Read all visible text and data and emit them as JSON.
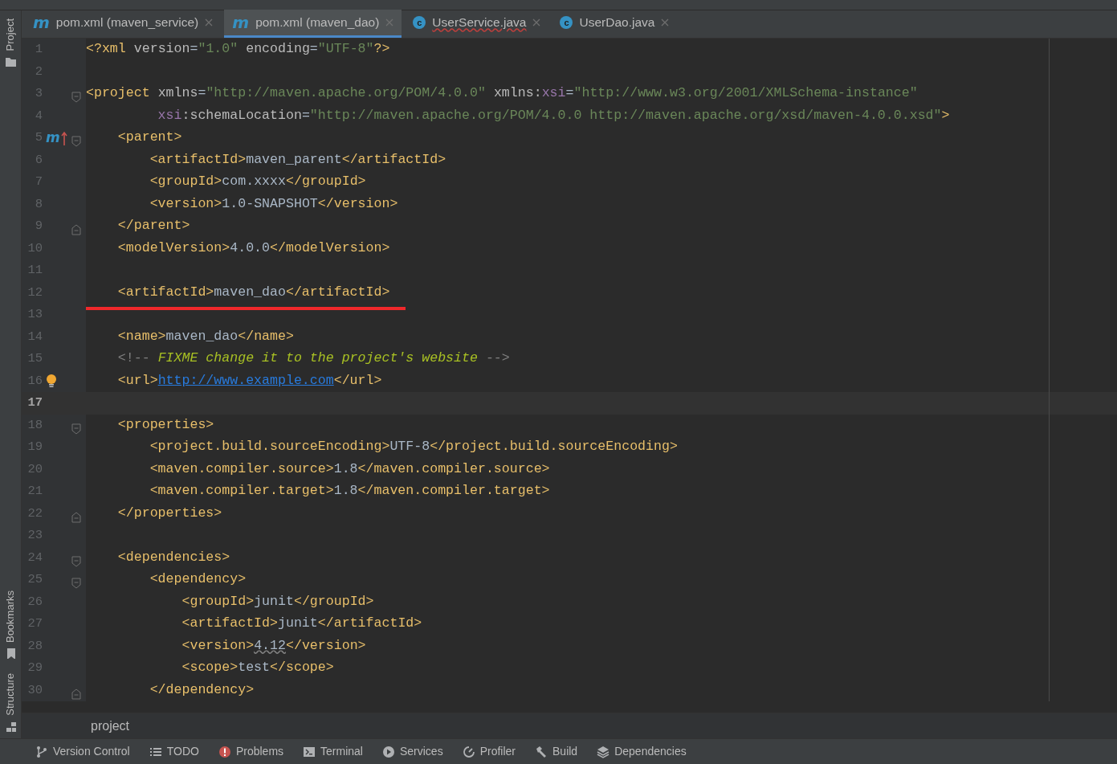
{
  "tool_strip": [
    {
      "label": "Project"
    },
    {
      "label": "Bookmarks"
    },
    {
      "label": "Structure"
    }
  ],
  "tabs": [
    {
      "letter": "m",
      "kind": "maven",
      "label": "pom.xml (maven_service)",
      "selected": false,
      "error": false
    },
    {
      "letter": "m",
      "kind": "maven",
      "label": "pom.xml (maven_dao)",
      "selected": true,
      "error": false
    },
    {
      "letter": "c",
      "kind": "class",
      "label": "UserService.java",
      "selected": false,
      "error": true
    },
    {
      "letter": "c",
      "kind": "class",
      "label": "UserDao.java",
      "selected": false,
      "error": false
    }
  ],
  "editor": {
    "lines": [
      {
        "n": "1",
        "current": false,
        "underlined": false,
        "code": [
          {
            "kind": "tag",
            "text": "<?xml"
          },
          {
            "kind": "attr",
            "text": " version"
          },
          {
            "kind": "plain",
            "text": "="
          },
          {
            "kind": "string",
            "text": "\"1.0\""
          },
          {
            "kind": "attr",
            "text": " encoding"
          },
          {
            "kind": "plain",
            "text": "="
          },
          {
            "kind": "string",
            "text": "\"UTF-8\""
          },
          {
            "kind": "tag",
            "text": "?>"
          }
        ]
      },
      {
        "n": "2",
        "current": false,
        "underlined": false
      },
      {
        "n": "3",
        "current": false,
        "underlined": false,
        "fold": {
          "kind": "start"
        },
        "code": [
          {
            "kind": "tag",
            "text": "<project"
          },
          {
            "kind": "attr",
            "text": " xmlns"
          },
          {
            "kind": "plain",
            "text": "="
          },
          {
            "kind": "string",
            "text": "\"http://maven.apache.org/POM/4.0.0\""
          },
          {
            "kind": "attr",
            "text": " xmlns:"
          },
          {
            "kind": "ns",
            "text": "xsi"
          },
          {
            "kind": "plain",
            "text": "="
          },
          {
            "kind": "string",
            "text": "\"http://www.w3.org/2001/XMLSchema-instance\""
          }
        ]
      },
      {
        "n": "4",
        "current": false,
        "underlined": false,
        "code": [
          {
            "kind": "ns",
            "text": "         xsi"
          },
          {
            "kind": "attr",
            "text": ":schemaLocation"
          },
          {
            "kind": "plain",
            "text": "="
          },
          {
            "kind": "string",
            "text": "\"http://maven.apache.org/POM/4.0.0 http://maven.apache.org/xsd/maven-4.0.0.xsd\""
          },
          {
            "kind": "tag",
            "text": ">"
          }
        ]
      },
      {
        "n": "5",
        "current": false,
        "underlined": false,
        "fold": {
          "kind": "start"
        },
        "marker": "m",
        "code": [
          {
            "kind": "tag",
            "text": "    <parent>"
          }
        ]
      },
      {
        "n": "6",
        "current": false,
        "underlined": false,
        "code": [
          {
            "kind": "tag",
            "text": "        <artifactId>"
          },
          {
            "kind": "plain",
            "text": "maven_parent"
          },
          {
            "kind": "tag",
            "text": "</artifactId>"
          }
        ]
      },
      {
        "n": "7",
        "current": false,
        "underlined": false,
        "code": [
          {
            "kind": "tag",
            "text": "        <groupId>"
          },
          {
            "kind": "plain",
            "text": "com.xxxx"
          },
          {
            "kind": "tag",
            "text": "</groupId>"
          }
        ]
      },
      {
        "n": "8",
        "current": false,
        "underlined": false,
        "code": [
          {
            "kind": "tag",
            "text": "        <version>"
          },
          {
            "kind": "plain",
            "text": "1.0-SNAPSHOT"
          },
          {
            "kind": "tag",
            "text": "</version>"
          }
        ]
      },
      {
        "n": "9",
        "current": false,
        "underlined": false,
        "fold": {
          "kind": "end"
        },
        "code": [
          {
            "kind": "tag",
            "text": "    </parent>"
          }
        ]
      },
      {
        "n": "10",
        "current": false,
        "underlined": false,
        "code": [
          {
            "kind": "tag",
            "text": "    <modelVersion>"
          },
          {
            "kind": "plain",
            "text": "4.0.0"
          },
          {
            "kind": "tag",
            "text": "</modelVersion>"
          }
        ]
      },
      {
        "n": "11",
        "current": false,
        "underlined": false
      },
      {
        "n": "12",
        "current": false,
        "underlined": true,
        "code": [
          {
            "kind": "tag",
            "text": "    <artifactId>"
          },
          {
            "kind": "plain",
            "text": "maven_dao"
          },
          {
            "kind": "tag",
            "text": "</artifactId>"
          }
        ]
      },
      {
        "n": "13",
        "current": false,
        "underlined": false
      },
      {
        "n": "14",
        "current": false,
        "underlined": false,
        "code": [
          {
            "kind": "tag",
            "text": "    <name>"
          },
          {
            "kind": "plain",
            "text": "maven_dao"
          },
          {
            "kind": "tag",
            "text": "</name>"
          }
        ]
      },
      {
        "n": "15",
        "current": false,
        "underlined": false,
        "code": [
          {
            "kind": "comment",
            "text": "    <!-- "
          },
          {
            "kind": "todo",
            "text": "FIXME change it to the project's website"
          },
          {
            "kind": "comment",
            "text": " -->"
          }
        ]
      },
      {
        "n": "16",
        "current": false,
        "underlined": false,
        "bulb": true,
        "code": [
          {
            "kind": "tag",
            "text": "    <url>"
          },
          {
            "kind": "link",
            "text": "http://www.example.com"
          },
          {
            "kind": "tag",
            "text": "</url>"
          }
        ]
      },
      {
        "n": "17",
        "current": true,
        "underlined": false
      },
      {
        "n": "18",
        "current": false,
        "underlined": false,
        "fold": {
          "kind": "start"
        },
        "code": [
          {
            "kind": "tag",
            "text": "    <properties>"
          }
        ]
      },
      {
        "n": "19",
        "current": false,
        "underlined": false,
        "code": [
          {
            "kind": "tag",
            "text": "        <project.build.sourceEncoding>"
          },
          {
            "kind": "plain",
            "text": "UTF-8"
          },
          {
            "kind": "tag",
            "text": "</project.build.sourceEncoding>"
          }
        ]
      },
      {
        "n": "20",
        "current": false,
        "underlined": false,
        "code": [
          {
            "kind": "tag",
            "text": "        <maven.compiler.source>"
          },
          {
            "kind": "plain",
            "text": "1.8"
          },
          {
            "kind": "tag",
            "text": "</maven.compiler.source>"
          }
        ]
      },
      {
        "n": "21",
        "current": false,
        "underlined": false,
        "code": [
          {
            "kind": "tag",
            "text": "        <maven.compiler.target>"
          },
          {
            "kind": "plain",
            "text": "1.8"
          },
          {
            "kind": "tag",
            "text": "</maven.compiler.target>"
          }
        ]
      },
      {
        "n": "22",
        "current": false,
        "underlined": false,
        "fold": {
          "kind": "end"
        },
        "code": [
          {
            "kind": "tag",
            "text": "    </properties>"
          }
        ]
      },
      {
        "n": "23",
        "current": false,
        "underlined": false
      },
      {
        "n": "24",
        "current": false,
        "underlined": false,
        "fold": {
          "kind": "start"
        },
        "code": [
          {
            "kind": "tag",
            "text": "    <dependencies>"
          }
        ]
      },
      {
        "n": "25",
        "current": false,
        "underlined": false,
        "fold": {
          "kind": "start"
        },
        "code": [
          {
            "kind": "tag",
            "text": "        <dependency>"
          }
        ]
      },
      {
        "n": "26",
        "current": false,
        "underlined": false,
        "code": [
          {
            "kind": "tag",
            "text": "            <groupId>"
          },
          {
            "kind": "plain",
            "text": "junit"
          },
          {
            "kind": "tag",
            "text": "</groupId>"
          }
        ]
      },
      {
        "n": "27",
        "current": false,
        "underlined": false,
        "code": [
          {
            "kind": "tag",
            "text": "            <artifactId>"
          },
          {
            "kind": "plain",
            "text": "junit"
          },
          {
            "kind": "tag",
            "text": "</artifactId>"
          }
        ]
      },
      {
        "n": "28",
        "current": false,
        "underlined": false,
        "code": [
          {
            "kind": "tag",
            "text": "            <version>"
          },
          {
            "kind": "typo",
            "text": "4.12"
          },
          {
            "kind": "tag",
            "text": "</version>"
          }
        ]
      },
      {
        "n": "29",
        "current": false,
        "underlined": false,
        "code": [
          {
            "kind": "tag",
            "text": "            <scope>"
          },
          {
            "kind": "plain",
            "text": "test"
          },
          {
            "kind": "tag",
            "text": "</scope>"
          }
        ]
      },
      {
        "n": "30",
        "current": false,
        "underlined": false,
        "fold": {
          "kind": "end"
        },
        "code": [
          {
            "kind": "tag",
            "text": "        </dependency>"
          }
        ]
      }
    ]
  },
  "breadcrumb": "project",
  "toolbar": [
    {
      "label": "Version Control"
    },
    {
      "label": "TODO"
    },
    {
      "label": "Problems"
    },
    {
      "label": "Terminal"
    },
    {
      "label": "Services"
    },
    {
      "label": "Profiler"
    },
    {
      "label": "Build"
    },
    {
      "label": "Dependencies"
    }
  ]
}
